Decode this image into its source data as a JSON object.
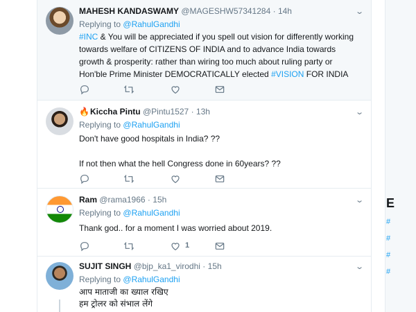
{
  "reply_to": "@RahulGandhi",
  "replying_label": "Replying to",
  "tweets": [
    {
      "name": "MAHESH KANDASWAMY",
      "handle": "@MAGESHW57341284",
      "time": "14h",
      "text_parts": [
        "#INC",
        " & You will be appreciated if you spell out vision for differently working towards welfare of CITIZENS OF INDIA and to advance India towards growth & prosperity: rather than wiring too much about ruling party or Hon'ble Prime Minister DEMOCRATICALLY elected ",
        "#VISION",
        " FOR INDIA"
      ],
      "avatar_icon": "profile-photo",
      "like_count": ""
    },
    {
      "name": "Kiccha Pintu",
      "name_prefix": "🔥",
      "handle": "@Pintu1527",
      "time": "13h",
      "lines": [
        "Don't have good hospitals in India? ??",
        "If not then what the hell Congress done in 60years? ??"
      ],
      "avatar_icon": "profile-photo",
      "like_count": ""
    },
    {
      "name": "Ram",
      "handle": "@rama1966",
      "time": "15h",
      "lines": [
        "Thank god.. for a moment I was worried about 2019."
      ],
      "avatar_icon": "indian-flag",
      "like_count": "1"
    },
    {
      "name": "SUJIT SINGH",
      "handle": "@bjp_ka1_virodhi",
      "time": "15h",
      "lines": [
        "आप माताजी का ख्याल रखिए",
        "हम ट्रोलर को संभाल लेंगे"
      ],
      "avatar_icon": "profile-photo",
      "like_count": ""
    }
  ],
  "sidebar": {
    "heading_letter": "E",
    "hash_marks": [
      "#",
      "#",
      "#",
      "#"
    ]
  },
  "colors": {
    "accent": "#1da1f2",
    "muted": "#657786",
    "text": "#14171a",
    "border": "#e6ecf0",
    "highlight_bg": "#f5f8fa"
  }
}
